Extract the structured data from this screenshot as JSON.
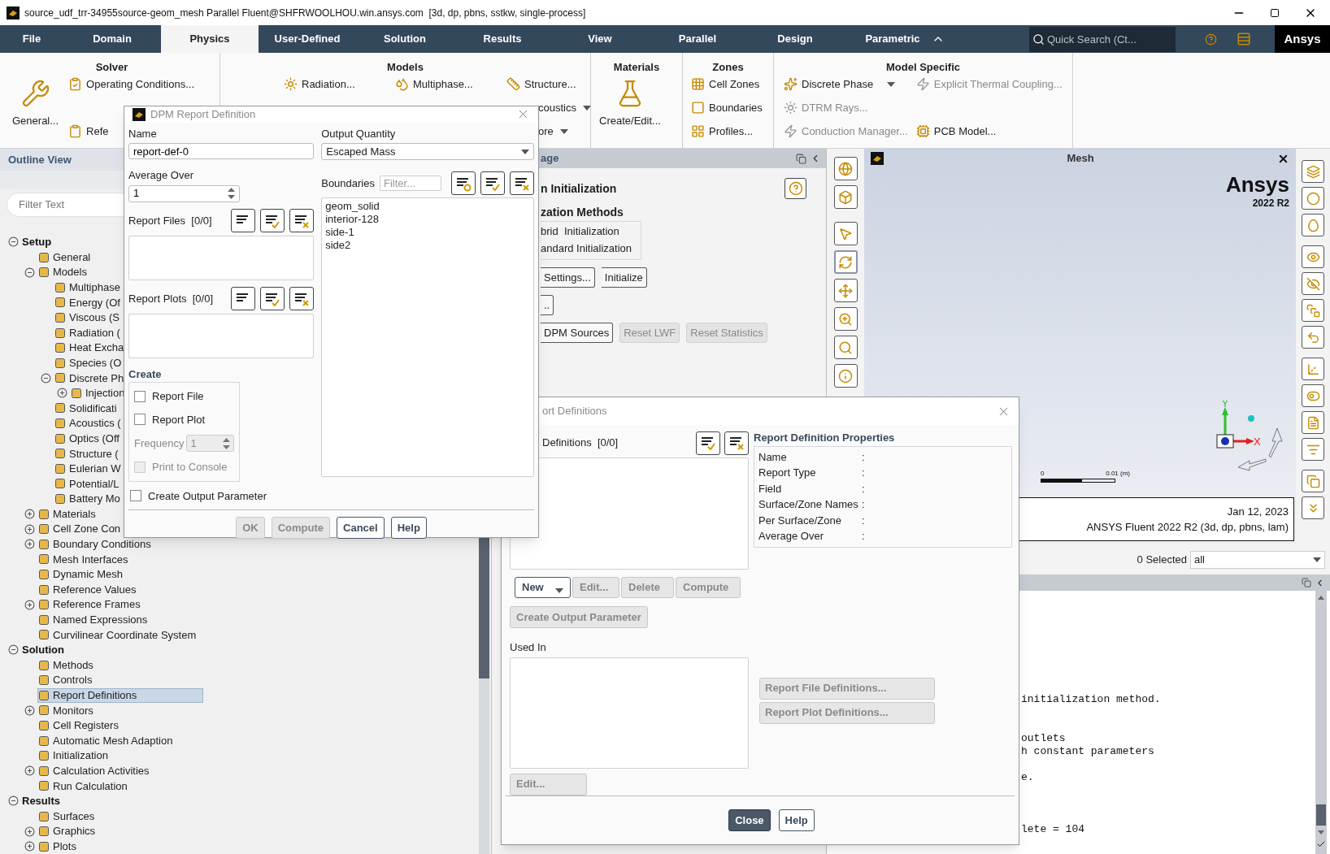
{
  "window": {
    "title": "source_udf_trr-34955source-geom_mesh Parallel Fluent@SHFRWOOLHOU.win.ansys.com  [3d, dp, pbns, sstkw, single-process]"
  },
  "menu_tabs": [
    {
      "label": "File",
      "selected": false
    },
    {
      "label": "Domain",
      "selected": false
    },
    {
      "label": "Physics",
      "selected": true
    },
    {
      "label": "User-Defined",
      "selected": false
    },
    {
      "label": "Solution",
      "selected": false
    },
    {
      "label": "Results",
      "selected": false
    },
    {
      "label": "View",
      "selected": false
    },
    {
      "label": "Parallel",
      "selected": false
    },
    {
      "label": "Design",
      "selected": false
    },
    {
      "label": "Parametric",
      "selected": false
    }
  ],
  "quick_search": {
    "placeholder": "Quick Search (Ct..."
  },
  "brand": "Ansys",
  "ribbon": [
    {
      "title": "Solver",
      "columns": [
        [
          {
            "label": "General...",
            "kind": "large",
            "disabled": false,
            "menu": false
          }
        ],
        [
          {
            "label": "Operating Conditions...",
            "kind": "small",
            "disabled": false,
            "menu": false
          },
          {
            "label": "Refe",
            "kind": "small",
            "disabled": false,
            "menu": false
          }
        ]
      ]
    },
    {
      "title": "Models",
      "columns": [
        [
          {
            "label": "Radiation...",
            "kind": "small",
            "disabled": false,
            "menu": false
          }
        ],
        [
          {
            "label": "Multiphase...",
            "kind": "small",
            "disabled": false,
            "menu": false
          }
        ],
        [
          {
            "label": "Structure...",
            "kind": "small",
            "disabled": false,
            "menu": false
          },
          {
            "label": "coustics",
            "kind": "bare",
            "disabled": false,
            "menu": true
          },
          {
            "label": "ore",
            "kind": "bare",
            "disabled": false,
            "menu": true
          }
        ]
      ]
    },
    {
      "title": "Materials",
      "columns": [
        [
          {
            "label": "Create/Edit...",
            "kind": "large",
            "disabled": false,
            "menu": false
          }
        ]
      ]
    },
    {
      "title": "Zones",
      "columns": [
        [
          {
            "label": "Cell Zones",
            "kind": "small",
            "disabled": false,
            "menu": false
          },
          {
            "label": "Boundaries",
            "kind": "small",
            "disabled": false,
            "menu": false
          },
          {
            "label": "Profiles...",
            "kind": "small",
            "disabled": false,
            "menu": false
          }
        ]
      ]
    },
    {
      "title": "Model Specific",
      "columns": [
        [
          {
            "label": "Discrete Phase",
            "kind": "small",
            "disabled": false,
            "menu": true
          },
          {
            "label": "DTRM Rays...",
            "kind": "small",
            "disabled": true,
            "menu": false
          },
          {
            "label": "Conduction Manager...",
            "kind": "small",
            "disabled": true,
            "menu": false
          }
        ],
        [
          {
            "label": "Explicit Thermal Coupling...",
            "kind": "small",
            "disabled": true,
            "menu": false
          },
          {
            "label": "PCB Model...",
            "kind": "small",
            "disabled": false,
            "menu": false
          }
        ]
      ]
    }
  ],
  "outline": {
    "title": "Outline View",
    "filter_placeholder": "Filter Text",
    "tree": [
      {
        "label": "Setup",
        "selected": false,
        "expanded": true,
        "children": [
          {
            "label": "General",
            "selected": false
          },
          {
            "label": "Models",
            "selected": false,
            "expanded": true,
            "children": [
              {
                "label": "Multiphase",
                "selected": false
              },
              {
                "label": "Energy (Of",
                "selected": false
              },
              {
                "label": "Viscous (S",
                "selected": false
              },
              {
                "label": "Radiation (",
                "selected": false
              },
              {
                "label": "Heat Excha",
                "selected": false
              },
              {
                "label": "Species (O",
                "selected": false
              },
              {
                "label": "Discrete Ph",
                "selected": false,
                "expanded": true,
                "children": [
                  {
                    "label": "Injection",
                    "selected": false,
                    "expanded": false
                  }
                ]
              },
              {
                "label": "Solidificati",
                "selected": false
              },
              {
                "label": "Acoustics (",
                "selected": false
              },
              {
                "label": "Optics (Off",
                "selected": false
              },
              {
                "label": "Structure (",
                "selected": false
              },
              {
                "label": "Eulerian W",
                "selected": false
              },
              {
                "label": "Potential/L",
                "selected": false
              },
              {
                "label": "Battery Mo",
                "selected": false
              }
            ]
          },
          {
            "label": "Materials",
            "selected": false,
            "expanded": false
          },
          {
            "label": "Cell Zone Con",
            "selected": false,
            "expanded": false
          },
          {
            "label": "Boundary Conditions",
            "selected": false,
            "expanded": false
          },
          {
            "label": "Mesh Interfaces",
            "selected": false
          },
          {
            "label": "Dynamic Mesh",
            "selected": false
          },
          {
            "label": "Reference Values",
            "selected": false
          },
          {
            "label": "Reference Frames",
            "selected": false,
            "expanded": false
          },
          {
            "label": "Named Expressions",
            "selected": false
          },
          {
            "label": "Curvilinear Coordinate System",
            "selected": false
          }
        ]
      },
      {
        "label": "Solution",
        "selected": false,
        "expanded": true,
        "children": [
          {
            "label": "Methods",
            "selected": false
          },
          {
            "label": "Controls",
            "selected": false
          },
          {
            "label": "Report Definitions",
            "selected": true
          },
          {
            "label": "Monitors",
            "selected": false,
            "expanded": false
          },
          {
            "label": "Cell Registers",
            "selected": false
          },
          {
            "label": "Automatic Mesh Adaption",
            "selected": false
          },
          {
            "label": "Initialization",
            "selected": false
          },
          {
            "label": "Calculation Activities",
            "selected": false,
            "expanded": false
          },
          {
            "label": "Run Calculation",
            "selected": false
          }
        ]
      },
      {
        "label": "Results",
        "selected": false,
        "expanded": true,
        "children": [
          {
            "label": "Surfaces",
            "selected": false
          },
          {
            "label": "Graphics",
            "selected": false,
            "expanded": false
          },
          {
            "label": "Plots",
            "selected": false,
            "expanded": false
          }
        ]
      }
    ]
  },
  "task_page": {
    "title": "age",
    "heading": "n Initialization",
    "methods_title": "zation Methods",
    "methods": [
      "brid  Initialization",
      "andard Initialization"
    ],
    "button_rows": [
      [
        {
          "label": "Settings...",
          "disabled": false
        },
        {
          "label": "Initialize",
          "disabled": false
        }
      ],
      [
        {
          "label": "..",
          "disabled": false
        }
      ],
      [
        {
          "label": "DPM Sources",
          "disabled": false
        },
        {
          "label": "Reset LWF",
          "disabled": true
        },
        {
          "label": "Reset Statistics",
          "disabled": true
        }
      ]
    ]
  },
  "graphics_tools": [
    {
      "selected": false
    },
    {
      "selected": false
    },
    {
      "selected": false
    },
    {
      "selected": true
    },
    {
      "selected": false
    },
    {
      "selected": false
    },
    {
      "selected": false
    },
    {
      "selected": false
    }
  ],
  "mesh_view": {
    "title": "Mesh",
    "logo": "Ansys",
    "version": "2022 R2",
    "axis_x": "X",
    "axis_y": "Y",
    "scale_start": "0",
    "scale_end": "0.01 (m)",
    "date": "Jan 12, 2023",
    "product": "ANSYS Fluent 2022 R2 (3d, dp, pbns, lam)"
  },
  "selection": {
    "count": "0 Selected",
    "filter": "all"
  },
  "console": {
    "lines": [
      "initialization method.",
      "outlets",
      "h constant parameters",
      "e.",
      "lete = 104"
    ]
  },
  "dpm_dialog": {
    "title": "DPM Report Definition",
    "name_label": "Name",
    "name_value": "report-def-0",
    "average_label": "Average Over",
    "average_value": "1",
    "report_files": {
      "label": "Report Files",
      "count": "[0/0]"
    },
    "report_plots": {
      "label": "Report Plots",
      "count": "[0/0]"
    },
    "create_title": "Create",
    "create_options": [
      {
        "label": "Report File",
        "checked": false
      },
      {
        "label": "Report Plot",
        "checked": false
      }
    ],
    "frequency": {
      "label": "Frequency",
      "value": "1",
      "disabled": true
    },
    "print_to_console": {
      "label": "Print to Console",
      "checked": false,
      "disabled": true
    },
    "output_parameter": {
      "label": "Create Output Parameter",
      "checked": false
    },
    "output_quantity_label": "Output Quantity",
    "output_quantity": "Escaped Mass",
    "boundaries_label": "Boundaries",
    "filter_placeholder": "Filter...",
    "boundaries": [
      {
        "label": "geom_solid",
        "selected": false
      },
      {
        "label": "interior-128",
        "selected": false
      },
      {
        "label": "side-1",
        "selected": false
      },
      {
        "label": "side2",
        "selected": false
      }
    ],
    "buttons": [
      {
        "label": "OK",
        "disabled": true
      },
      {
        "label": "Compute",
        "disabled": true
      },
      {
        "label": "Cancel",
        "disabled": false
      },
      {
        "label": "Help",
        "disabled": false
      }
    ]
  },
  "report_definitions_dialog": {
    "title": "ort Definitions",
    "list_label": "Definitions",
    "list_count": "[0/0]",
    "actions": [
      {
        "label": "New",
        "disabled": false,
        "menu": true
      },
      {
        "label": "Edit...",
        "disabled": true,
        "menu": false
      },
      {
        "label": "Delete",
        "disabled": true,
        "menu": false
      },
      {
        "label": "Compute",
        "disabled": true,
        "menu": false
      }
    ],
    "output_parameter": {
      "label": "Create Output Parameter",
      "disabled": true
    },
    "used_in_label": "Used In",
    "used_in_edit": {
      "label": "Edit...",
      "disabled": true
    },
    "properties_title": "Report Definition Properties",
    "properties": [
      {
        "label": "Name",
        "separator": ":"
      },
      {
        "label": "Report Type",
        "separator": ":"
      },
      {
        "label": "Field",
        "separator": ":"
      },
      {
        "label": "Surface/Zone Names",
        "separator": ":"
      },
      {
        "label": "Per Surface/Zone",
        "separator": ":"
      },
      {
        "label": "Average Over",
        "separator": ":"
      }
    ],
    "definition_buttons": [
      {
        "label": "Report File Definitions...",
        "disabled": true
      },
      {
        "label": "Report Plot Definitions...",
        "disabled": true
      }
    ],
    "buttons": [
      {
        "label": "Close",
        "kind": "primary"
      },
      {
        "label": "Help",
        "kind": "normal"
      }
    ]
  }
}
